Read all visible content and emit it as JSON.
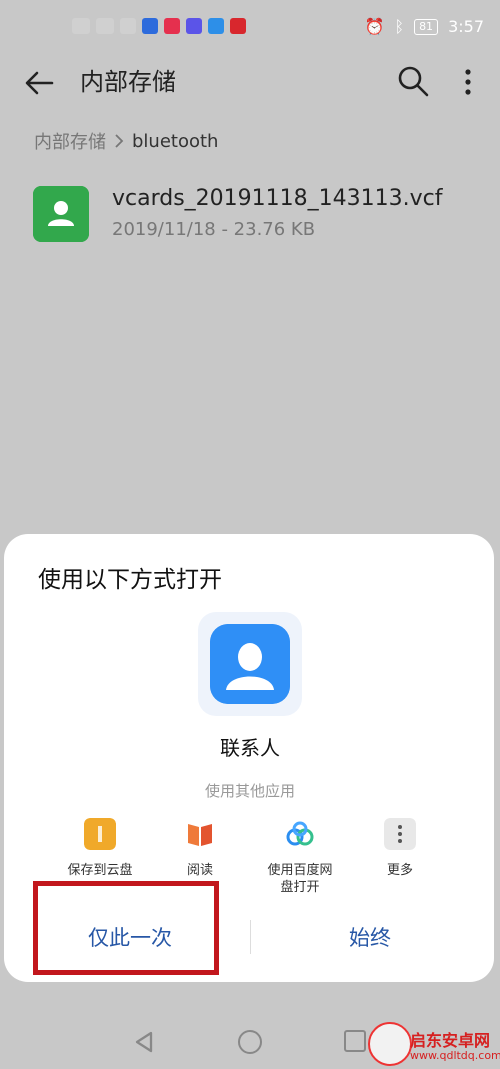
{
  "status_bar": {
    "time": "3:57",
    "battery": "81",
    "colors": {
      "icon1": "#2d6bdc",
      "icon2": "#e5304e",
      "icon3": "#5b54e8",
      "icon4": "#2d8fe8",
      "icon5": "#d8272d"
    }
  },
  "toolbar": {
    "title": "内部存储"
  },
  "breadcrumb": {
    "root": "内部存储",
    "current": "bluetooth"
  },
  "file": {
    "name": "vcards_20191118_143113.vcf",
    "meta": "2019/11/18 - 23.76 KB"
  },
  "sheet": {
    "title": "使用以下方式打开",
    "app_label": "联系人",
    "other_apps": "使用其他应用",
    "options": [
      {
        "label": "保存到云盘",
        "icon": "cloud-folder-icon"
      },
      {
        "label": "阅读",
        "icon": "book-icon"
      },
      {
        "label": "使用百度网盘打开",
        "icon": "baidu-netdisk-icon"
      },
      {
        "label": "更多",
        "icon": "more-icon"
      }
    ],
    "button_once": "仅此一次",
    "button_always": "始终"
  },
  "watermark": {
    "name": "启东安卓网",
    "url": "www.qdltdq.com"
  },
  "colors": {
    "accent": "#2757a6",
    "file_icon": "#32a84c",
    "app_icon": "#2f8ff6",
    "highlight": "#c2171d"
  }
}
